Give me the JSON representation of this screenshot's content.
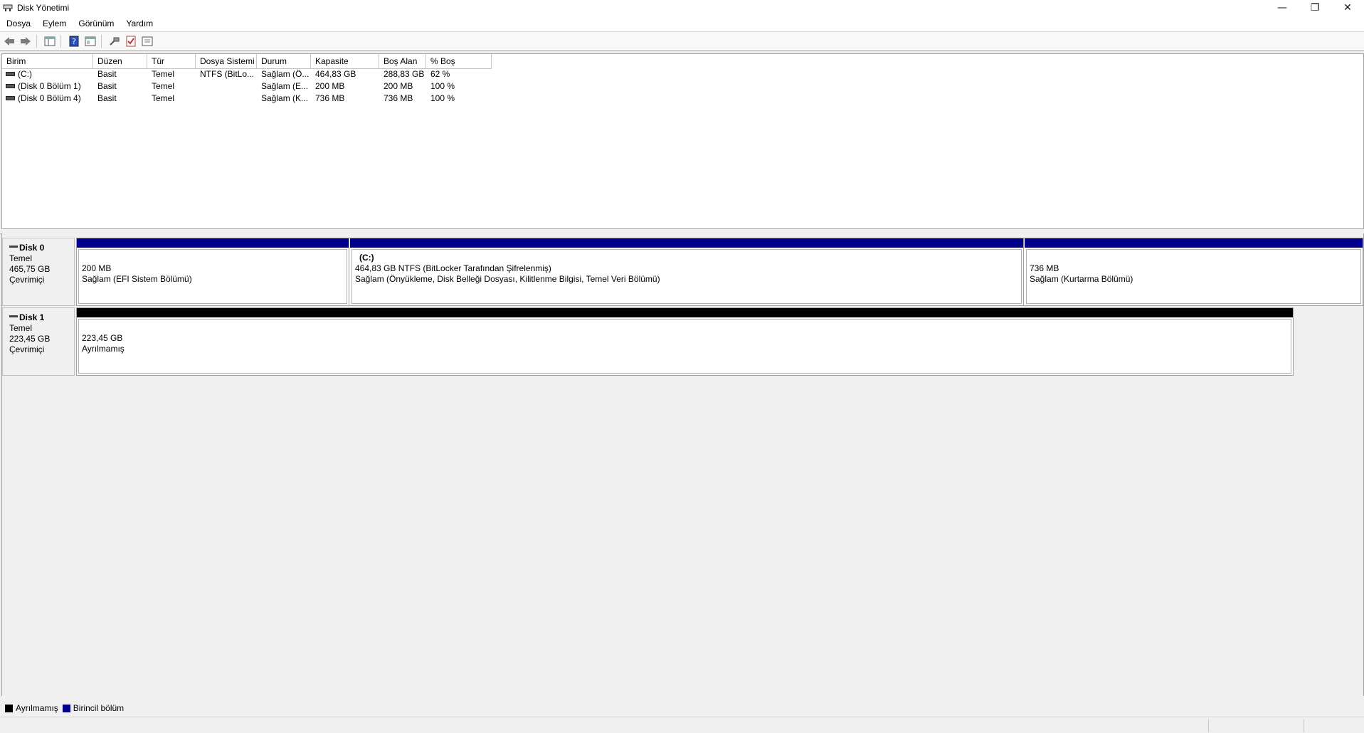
{
  "window": {
    "title": "Disk Yönetimi",
    "minimize": "—",
    "restore": "❐",
    "close": "✕"
  },
  "menu": [
    "Dosya",
    "Eylem",
    "Görünüm",
    "Yardım"
  ],
  "toolbar": {
    "icons": [
      "back-icon",
      "forward-icon",
      "show-hide-console-tree-icon",
      "help-icon",
      "properties-icon",
      "connect-icon",
      "checklist-icon",
      "view-icon"
    ]
  },
  "volume_table": {
    "columns": [
      "Birim",
      "Düzen",
      "Tür",
      "Dosya Sistemi",
      "Durum",
      "Kapasite",
      "Boş Alan",
      "% Boş"
    ],
    "rows": [
      [
        "(C:)",
        "Basit",
        "Temel",
        "NTFS (BitLo...",
        "Sağlam (Ö...",
        "464,83 GB",
        "288,83 GB",
        "62 %"
      ],
      [
        "(Disk 0 Bölüm 1)",
        "Basit",
        "Temel",
        "",
        "Sağlam (E...",
        "200 MB",
        "200 MB",
        "100 %"
      ],
      [
        "(Disk 0 Bölüm 4)",
        "Basit",
        "Temel",
        "",
        "Sağlam (K...",
        "736 MB",
        "736 MB",
        "100 %"
      ]
    ]
  },
  "disks": [
    {
      "name": "Disk 0",
      "type": "Temel",
      "size": "465,75 GB",
      "status": "Çevrimiçi",
      "partitions": [
        {
          "title": "",
          "line1": "200 MB",
          "line2": "Sağlam (EFI Sistem Bölümü)",
          "bar_color": "#00008b"
        },
        {
          "title": "(C:)",
          "line1": "464,83 GB NTFS (BitLocker Tarafından Şifrelenmiş)",
          "line2": "Sağlam (Önyükleme, Disk Belleği Dosyası, Kilitlenme Bilgisi, Temel Veri Bölümü)",
          "bar_color": "#00008b"
        },
        {
          "title": "",
          "line1": "736 MB",
          "line2": "Sağlam (Kurtarma Bölümü)",
          "bar_color": "#00008b"
        }
      ]
    },
    {
      "name": "Disk 1",
      "type": "Temel",
      "size": "223,45 GB",
      "status": "Çevrimiçi",
      "partitions": [
        {
          "title": "",
          "line1": "223,45 GB",
          "line2": "Ayrılmamış",
          "bar_color": "#000000"
        }
      ]
    }
  ],
  "legend": [
    {
      "label": "Ayrılmamış",
      "color": "#000000"
    },
    {
      "label": "Birincil bölüm",
      "color": "#00008b"
    }
  ]
}
